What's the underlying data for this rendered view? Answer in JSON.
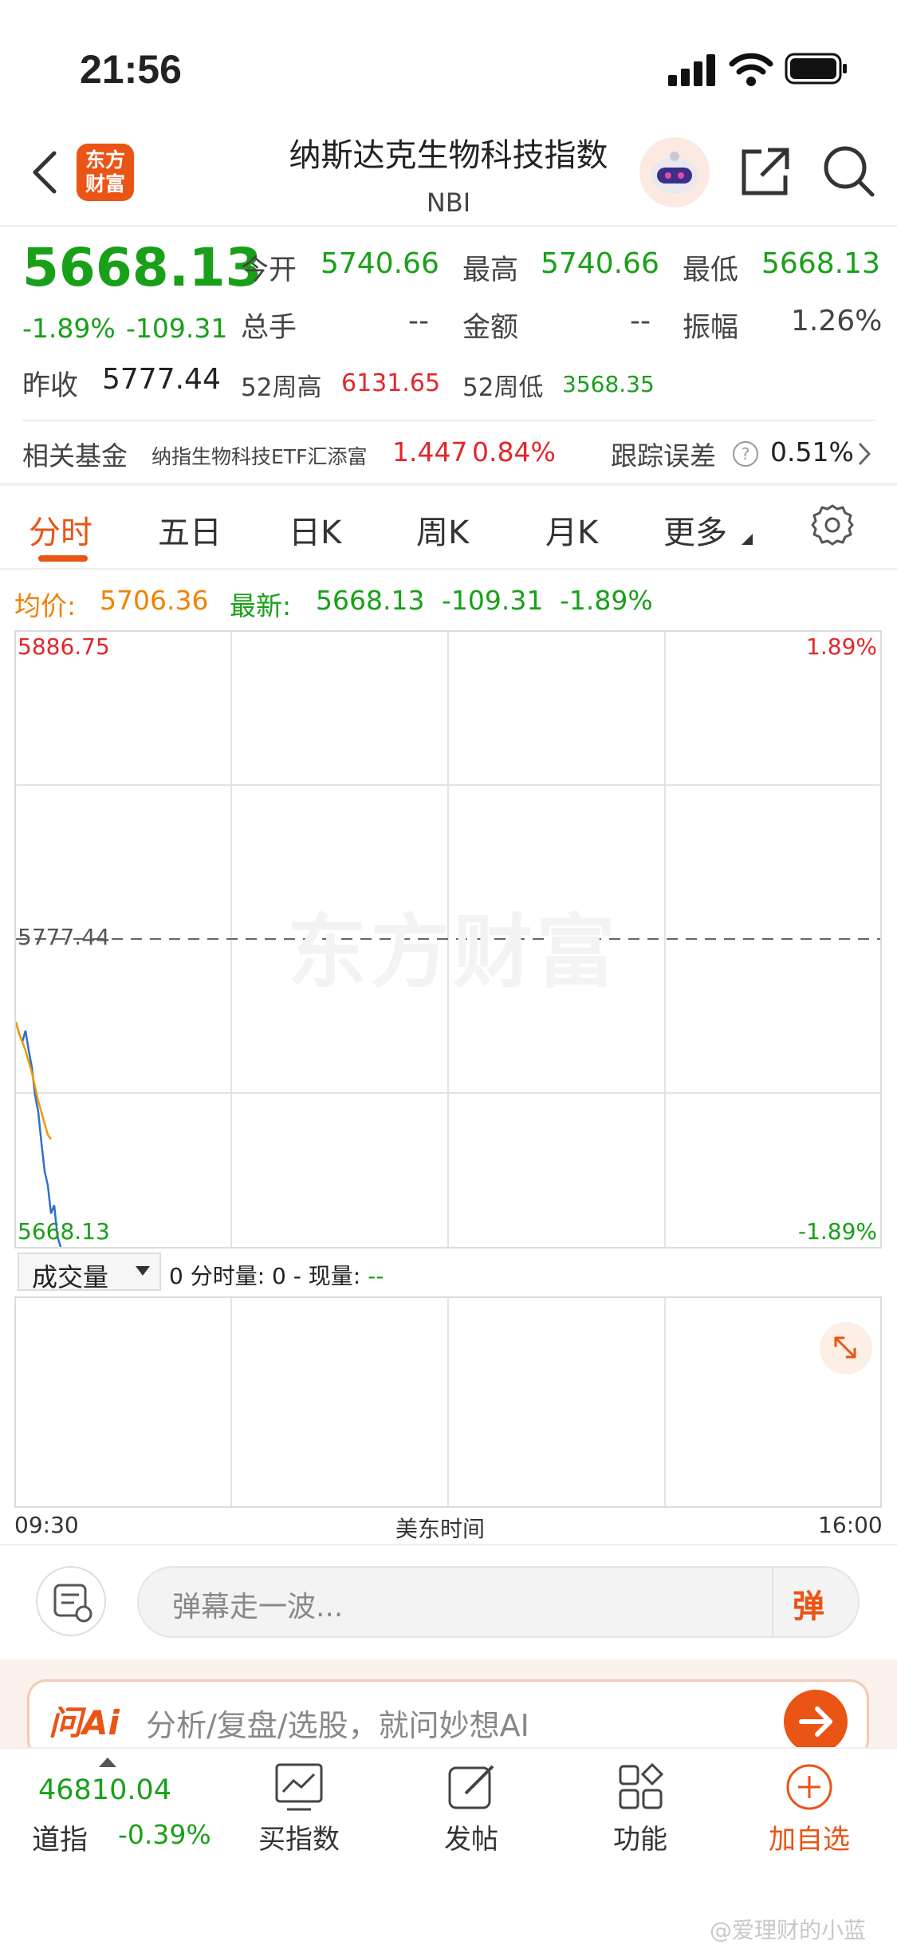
{
  "status": {
    "time": "21:56"
  },
  "header": {
    "logo_text_line1": "东方",
    "logo_text_line2": "财富",
    "title": "纳斯达克生物科技指数",
    "code": "NBI"
  },
  "quote": {
    "price": "5668.13",
    "change_pct": "-1.89%",
    "change": "-109.31",
    "open_label": "今开",
    "open": "5740.66",
    "high_label": "最高",
    "high": "5740.66",
    "low_label": "最低",
    "low": "5668.13",
    "volume_label": "总手",
    "volume": "--",
    "amount_label": "金额",
    "amount": "--",
    "amplitude_label": "振幅",
    "amplitude": "1.26%",
    "prev_close_label": "昨收",
    "prev_close": "5777.44",
    "wk52_high_label": "52周高",
    "wk52_high": "6131.65",
    "wk52_low_label": "52周低",
    "wk52_low": "3568.35"
  },
  "fund": {
    "label": "相关基金",
    "name": "纳指生物科技ETF汇添富",
    "price": "1.447",
    "pct": "0.84%",
    "tracking_label": "跟踪误差",
    "tracking_value": "0.51%"
  },
  "tabs": [
    {
      "label": "分时"
    },
    {
      "label": "五日"
    },
    {
      "label": "日K"
    },
    {
      "label": "周K"
    },
    {
      "label": "月K"
    },
    {
      "label": "更多"
    }
  ],
  "summary": {
    "avg_label": "均价:",
    "avg": "5706.36",
    "latest_label": "最新:",
    "latest": "5668.13",
    "change": "-109.31",
    "pct": "-1.89%"
  },
  "chart_data": {
    "type": "line",
    "y_max": "5886.75",
    "y_mid": "5777.44",
    "y_min": "5668.13",
    "pct_max": "1.89%",
    "pct_min": "-1.89%",
    "watermark": "东方财富",
    "x_start": "09:30",
    "x_mid": "美东时间",
    "x_end": "16:00",
    "ylim": [
      5668.13,
      5886.75
    ],
    "series": [
      {
        "values": [
          5748,
          5744,
          5741,
          5745,
          5738,
          5732,
          5722,
          5716,
          5705,
          5695,
          5690,
          5680,
          5683,
          5672,
          5668.13
        ]
      },
      {
        "values": [
          5748,
          5744,
          5741,
          5738,
          5734,
          5730,
          5725,
          5720,
          5716,
          5712,
          5708,
          5706.36
        ]
      }
    ]
  },
  "volume": {
    "selector": "成交量",
    "stats_prefix": "0  分时量: 0 - 现量: ",
    "stats_value": "--"
  },
  "danmu": {
    "placeholder": "弹幕走一波...",
    "button": "弹"
  },
  "ai": {
    "brand": "问Ai",
    "placeholder": "分析/复盘/选股，就问妙想AI"
  },
  "bottom_nav": {
    "index_value": "46810.04",
    "index_name": "道指",
    "index_pct": "-0.39%",
    "buy_label": "买指数",
    "post_label": "发帖",
    "func_label": "功能",
    "add_label": "加自选"
  },
  "watermark_user": "@爱理财的小蓝"
}
